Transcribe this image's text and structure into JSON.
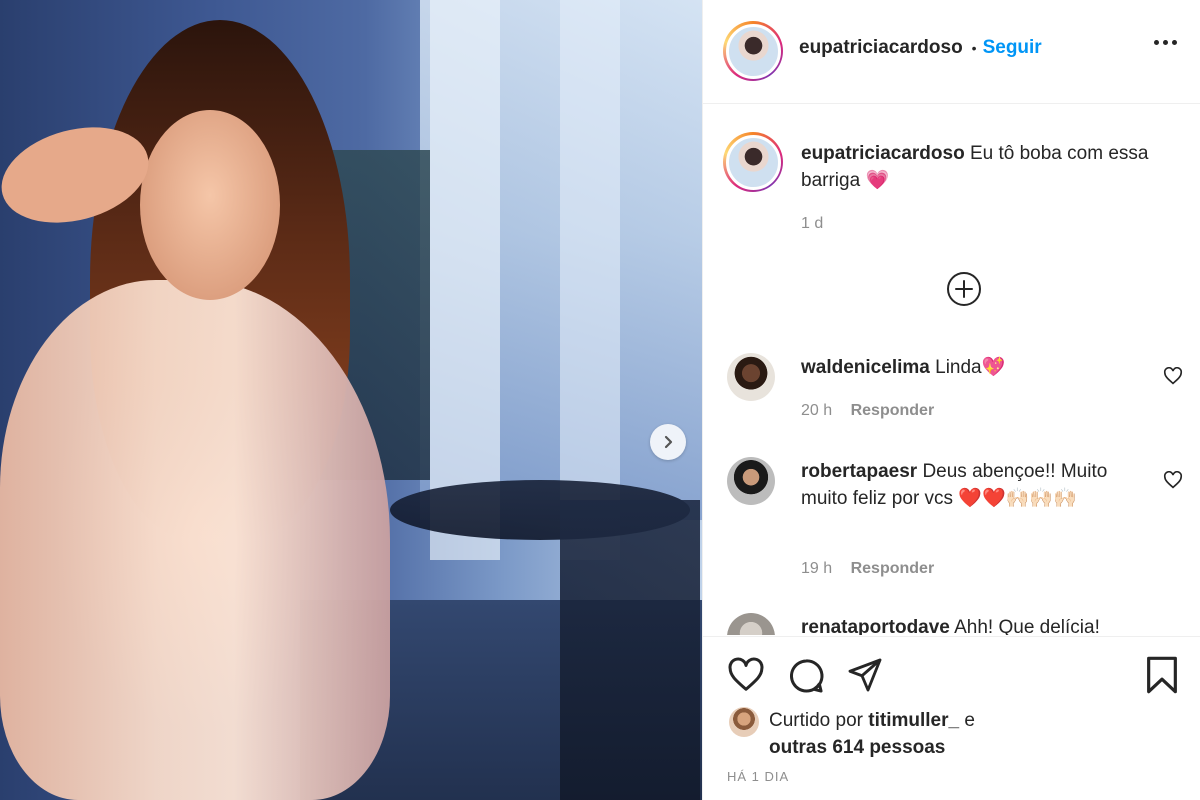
{
  "post": {
    "author": "eupatriciacardoso",
    "follow_label": "Seguir",
    "separator": "•",
    "caption": "Eu tô boba com essa barriga",
    "caption_emoji": "💗",
    "caption_age": "1 d"
  },
  "comments": [
    {
      "user": "waldenicelima",
      "text": "Linda",
      "emoji": "💖",
      "age": "20 h",
      "reply_label": "Responder"
    },
    {
      "user": "robertapaesr",
      "text": "Deus abençoe!! Muito muito feliz por vcs",
      "emoji": "❤️❤️🙌🏻🙌🏻🙌🏻",
      "age": "19 h",
      "reply_label": "Responder"
    },
    {
      "user": "renataportodave",
      "text": "Ahh! Que delícia!"
    }
  ],
  "likes": {
    "prefix": "Curtido por",
    "user": "titimuller_",
    "connector": "e",
    "others": "outras 614 pessoas"
  },
  "footer": {
    "timestamp": "HÁ 1 DIA"
  },
  "icons": [
    "chevron-right-icon",
    "more-icon",
    "plus-circle-icon",
    "heart-icon",
    "comment-icon",
    "share-icon",
    "bookmark-icon"
  ],
  "colors": {
    "link": "#0095f6",
    "text": "#262626",
    "muted": "#8e8e8e",
    "border": "#efefef"
  }
}
